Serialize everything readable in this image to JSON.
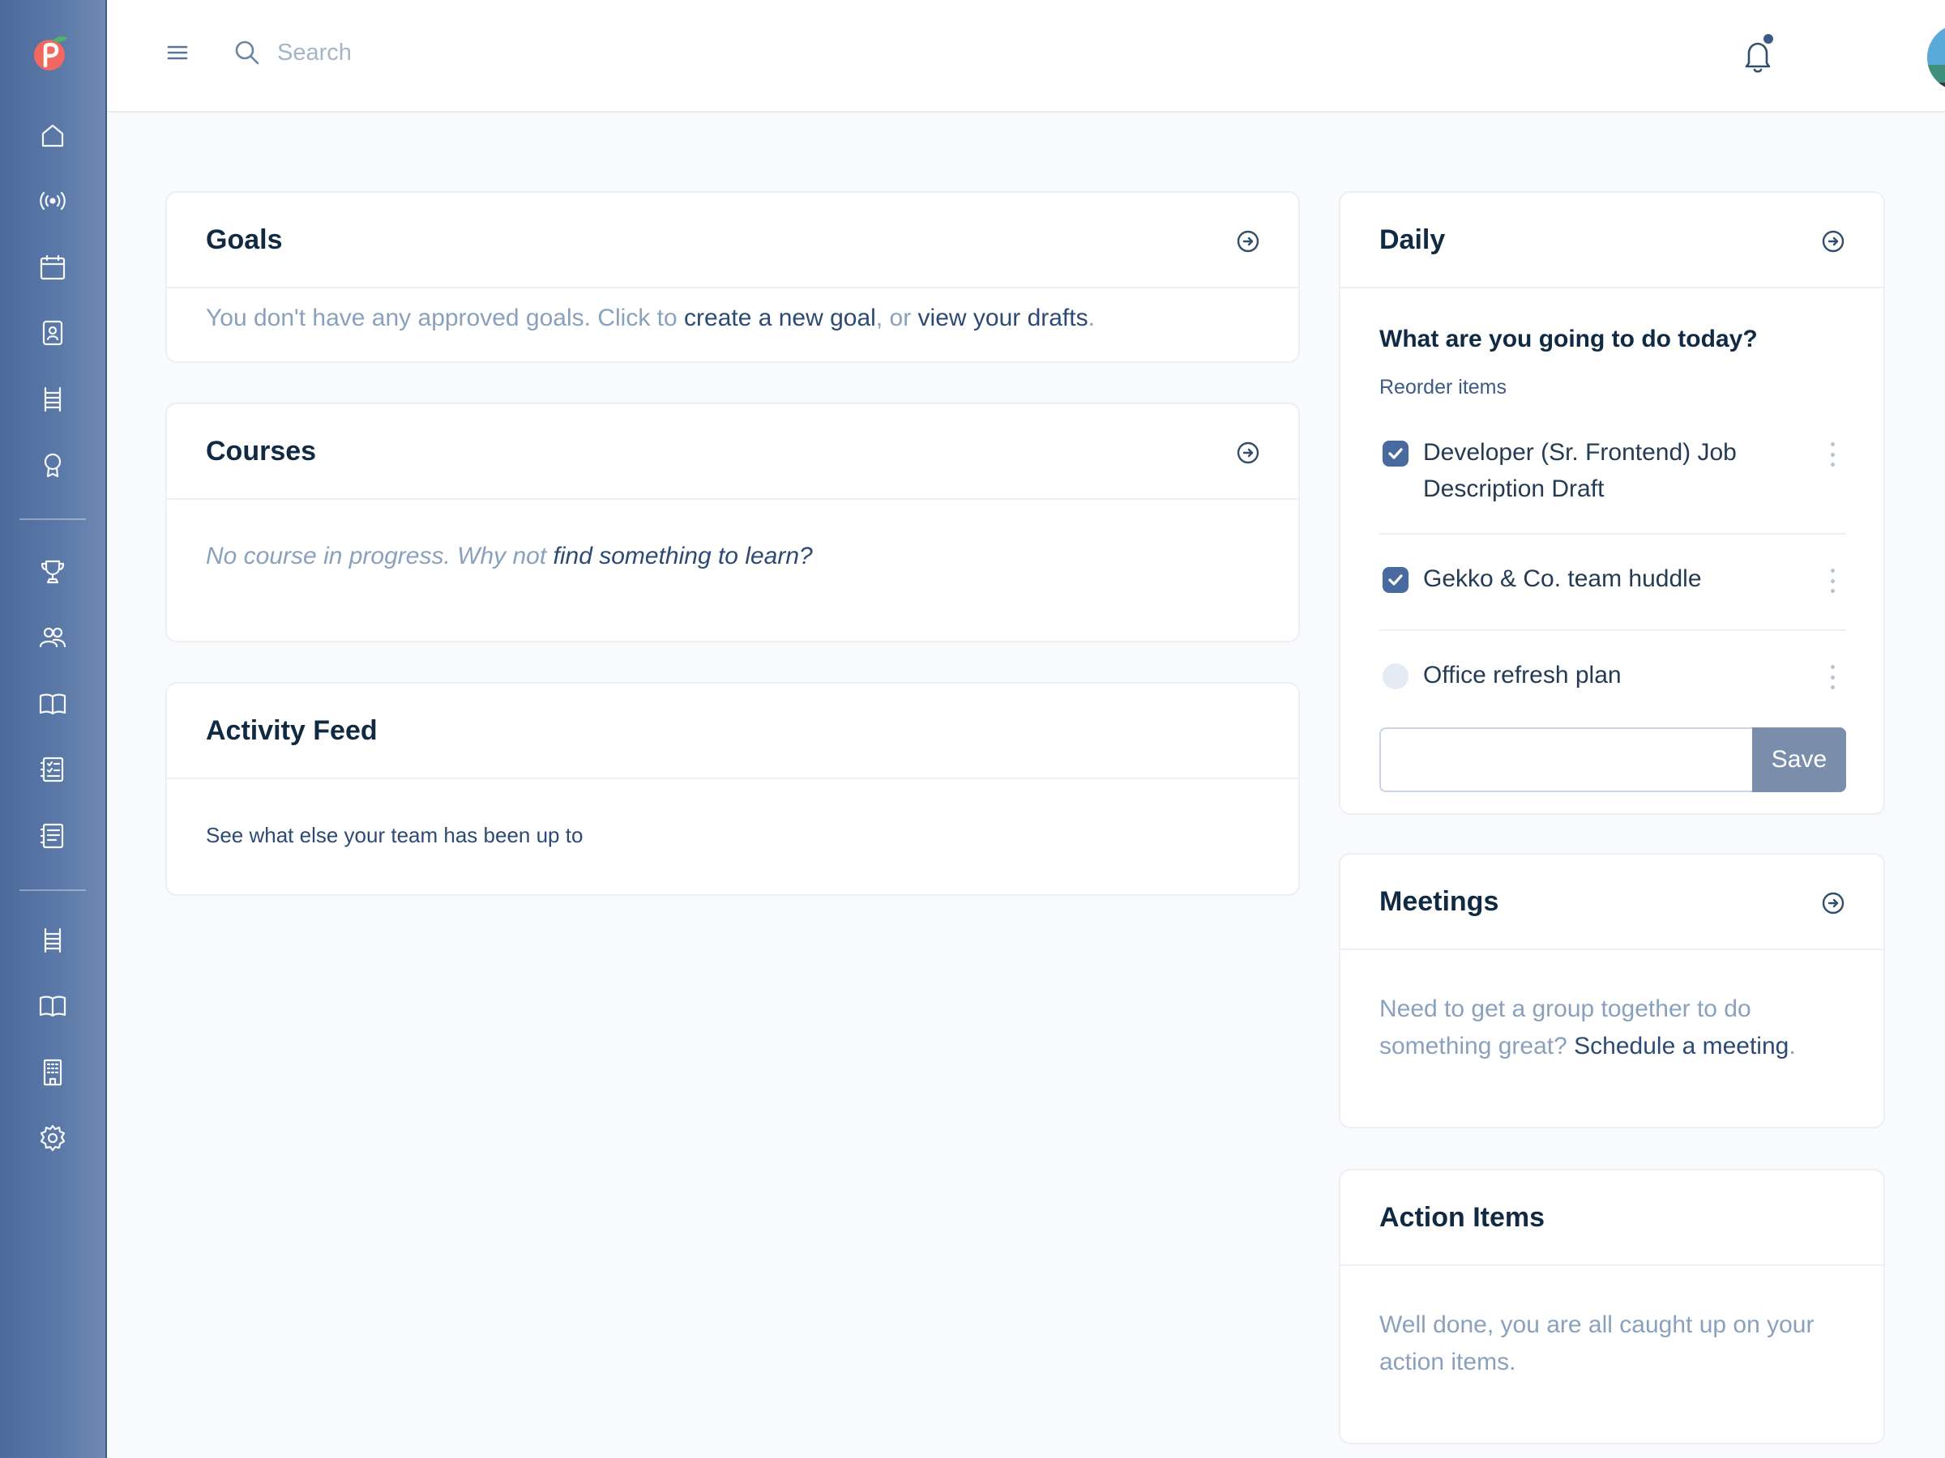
{
  "header": {
    "search_placeholder": "Search"
  },
  "sidebar": {
    "items": [
      {
        "icon": "home-icon"
      },
      {
        "icon": "broadcast-icon"
      },
      {
        "icon": "calendar-icon"
      },
      {
        "icon": "contact-card-icon"
      },
      {
        "icon": "ladder-icon"
      },
      {
        "icon": "award-icon"
      },
      {
        "icon": "trophy-icon"
      },
      {
        "icon": "people-icon"
      },
      {
        "icon": "book-icon"
      },
      {
        "icon": "checklist-icon"
      },
      {
        "icon": "notes-icon"
      },
      {
        "icon": "ladder-icon"
      },
      {
        "icon": "book-icon"
      },
      {
        "icon": "building-icon"
      },
      {
        "icon": "gear-icon"
      }
    ]
  },
  "goals": {
    "title": "Goals",
    "text_before": "You don't have any approved goals. Click to ",
    "link_create": "create a new goal",
    "text_middle": ", or ",
    "link_drafts": "view your drafts",
    "text_after": "."
  },
  "courses": {
    "title": "Courses",
    "text": "No course in progress. Why not ",
    "link": "find something to learn?"
  },
  "activity": {
    "title": "Activity Feed",
    "text": "See what else your team has been up to"
  },
  "daily": {
    "title": "Daily",
    "question": "What are you going to do today?",
    "reorder": "Reorder items",
    "tasks": [
      {
        "label": "Developer (Sr. Frontend) Job Description Draft",
        "done": true
      },
      {
        "label": "Gekko & Co. team huddle",
        "done": true
      },
      {
        "label": "Office refresh plan",
        "done": false
      }
    ],
    "input_value": "",
    "save_label": "Save"
  },
  "meetings": {
    "title": "Meetings",
    "text": "Need to get a group together to do something great? ",
    "link": "Schedule a meeting",
    "text_after": "."
  },
  "action_items": {
    "title": "Action Items",
    "text": "Well done, you are all caught up on your action items."
  },
  "colors": {
    "sidebar": "#4b6a9b",
    "accent": "#486a9e",
    "muted_text": "#8aa1bd",
    "link": "#2c4a73",
    "save_button": "#7a8eab"
  }
}
